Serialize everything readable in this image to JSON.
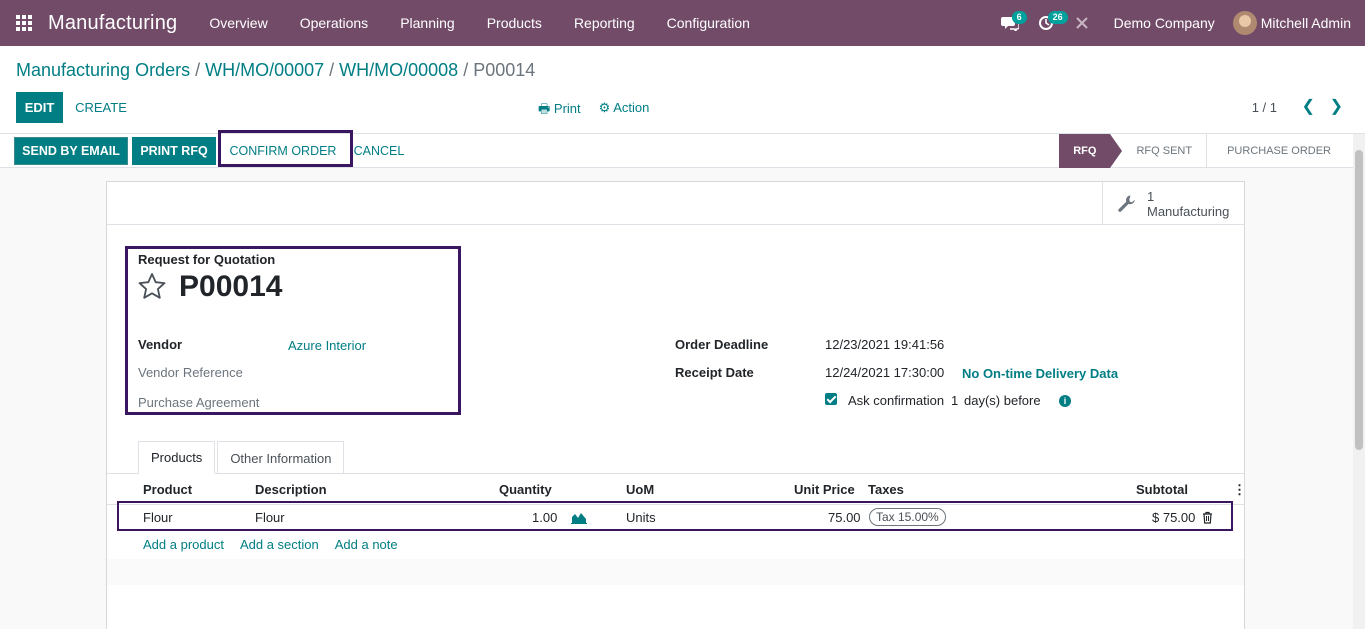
{
  "navbar": {
    "app_name": "Manufacturing",
    "menu": [
      "Overview",
      "Operations",
      "Planning",
      "Products",
      "Reporting",
      "Configuration"
    ],
    "messages_count": "6",
    "activities_count": "26",
    "company": "Demo Company",
    "user": "Mitchell Admin"
  },
  "breadcrumb": {
    "items": [
      "Manufacturing Orders",
      "WH/MO/00007",
      "WH/MO/00008"
    ],
    "separator": " / ",
    "current": "P00014"
  },
  "control": {
    "edit": "EDIT",
    "create": "CREATE",
    "print": "Print",
    "action": "Action",
    "pager": "1 / 1"
  },
  "statusbar": {
    "send_email": "SEND BY EMAIL",
    "print_rfq": "PRINT RFQ",
    "confirm": "CONFIRM ORDER",
    "cancel": "CANCEL",
    "stages": [
      "RFQ",
      "RFQ SENT",
      "PURCHASE ORDER"
    ],
    "active_stage": "RFQ"
  },
  "smart_button": {
    "count": "1",
    "label": "Manufacturing"
  },
  "form": {
    "title_label": "Request for Quotation",
    "name": "P00014",
    "vendor_label": "Vendor",
    "vendor_value": "Azure Interior",
    "vendor_ref_label": "Vendor Reference",
    "agreement_label": "Purchase Agreement",
    "order_deadline_label": "Order Deadline",
    "order_deadline_value": "12/23/2021 19:41:56",
    "receipt_date_label": "Receipt Date",
    "receipt_date_value": "12/24/2021 17:30:00",
    "delivery_data": "No On-time Delivery Data",
    "ask_confirmation": "Ask confirmation",
    "ask_days": "1",
    "ask_suffix": "day(s) before"
  },
  "tabs": [
    "Products",
    "Other Information"
  ],
  "table": {
    "headers": [
      "Product",
      "Description",
      "Quantity",
      "UoM",
      "Unit Price",
      "Taxes",
      "Subtotal"
    ],
    "rows": [
      {
        "product": "Flour",
        "description": "Flour",
        "quantity": "1.00",
        "uom": "Units",
        "unit_price": "75.00",
        "taxes": "Tax 15.00%",
        "subtotal": "$ 75.00"
      }
    ],
    "add_product": "Add a product",
    "add_section": "Add a section",
    "add_note": "Add a note"
  },
  "colors": {
    "brand": "#714b67",
    "accent": "#017e84",
    "highlight": "#3b1660"
  }
}
